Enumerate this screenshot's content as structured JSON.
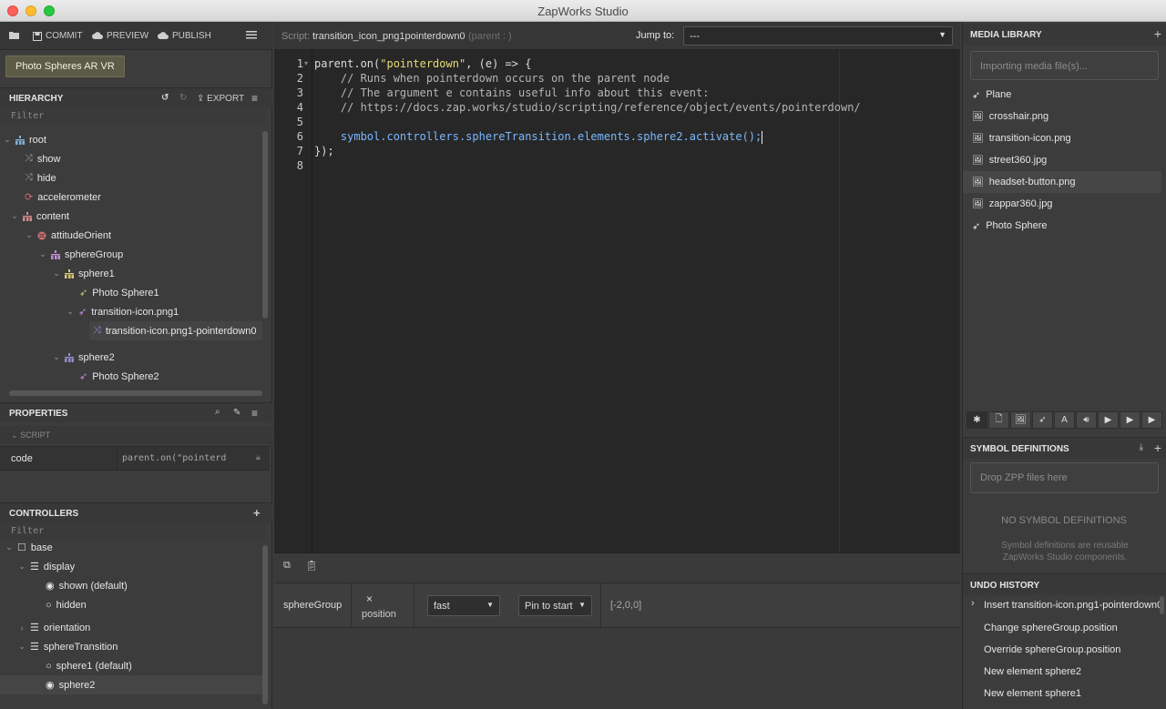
{
  "window": {
    "title": "ZapWorks Studio"
  },
  "toolbar": {
    "commit": "COMMIT",
    "preview": "PREVIEW",
    "publish": "PUBLISH"
  },
  "project": {
    "name": "Photo Spheres AR VR"
  },
  "hierarchy": {
    "title": "HIERARCHY",
    "export": "EXPORT",
    "filter_placeholder": "Filter",
    "items": [
      {
        "label": "root"
      },
      {
        "label": "show"
      },
      {
        "label": "hide"
      },
      {
        "label": "accelerometer"
      },
      {
        "label": "content"
      },
      {
        "label": "attitudeOrient"
      },
      {
        "label": "sphereGroup"
      },
      {
        "label": "sphere1"
      },
      {
        "label": "Photo Sphere1"
      },
      {
        "label": "transition-icon.png1"
      },
      {
        "label": "transition-icon.png1-pointerdown0"
      },
      {
        "label": "sphere2"
      },
      {
        "label": "Photo Sphere2"
      }
    ]
  },
  "properties": {
    "title": "PROPERTIES",
    "group": "SCRIPT",
    "code_label": "code",
    "code_value": "parent.on(\"pointerd"
  },
  "controllers": {
    "title": "CONTROLLERS",
    "filter_placeholder": "Filter",
    "items": [
      {
        "label": "base"
      },
      {
        "label": "display"
      },
      {
        "label": "shown (default)"
      },
      {
        "label": "hidden"
      },
      {
        "label": "orientation"
      },
      {
        "label": "sphereTransition"
      },
      {
        "label": "sphere1 (default)"
      },
      {
        "label": "sphere2"
      }
    ]
  },
  "script": {
    "prefix": "Script:",
    "name": "transition_icon_png1pointerdown0",
    "parent": "(parent : )",
    "jump_label": "Jump to:",
    "jump_value": "---"
  },
  "code": {
    "line_numbers": [
      "1",
      "2",
      "3",
      "4",
      "5",
      "6",
      "7",
      "8"
    ],
    "l1a": "parent.on(",
    "l1b": "\"pointerdown\"",
    "l1c": ", (e) => {",
    "l2": "    // Runs when pointerdown occurs on the parent node",
    "l3": "    // The argument e contains useful info about this event:",
    "l4": "    // https://docs.zap.works/studio/scripting/reference/object/events/pointerdown/",
    "l6": "    symbol.controllers.sphereTransition.elements.sphere2.activate();",
    "l7": "});"
  },
  "timeline": {
    "node": "sphereGroup",
    "prop_icon": "×",
    "prop": "position",
    "easing": "fast",
    "pin": "Pin to start",
    "value": "[-2,0,0]"
  },
  "media": {
    "title": "MEDIA LIBRARY",
    "import_placeholder": "Importing media file(s)...",
    "items": [
      {
        "label": "Plane",
        "icon": "rocket-icon"
      },
      {
        "label": "crosshair.png",
        "icon": "image-icon"
      },
      {
        "label": "transition-icon.png",
        "icon": "image-icon"
      },
      {
        "label": "street360.jpg",
        "icon": "image-icon"
      },
      {
        "label": "headset-button.png",
        "icon": "image-icon"
      },
      {
        "label": "zappar360.jpg",
        "icon": "image-icon"
      },
      {
        "label": "Photo Sphere",
        "icon": "rocket-icon"
      }
    ]
  },
  "symbols": {
    "title": "SYMBOL DEFINITIONS",
    "drop": "Drop ZPP files here",
    "empty_title": "NO SYMBOL DEFINITIONS",
    "empty_desc": "Symbol definitions are reusable ZapWorks Studio components."
  },
  "undo": {
    "title": "UNDO HISTORY",
    "items": [
      {
        "label": "Insert transition-icon.png1-pointerdown0"
      },
      {
        "label": "Change sphereGroup.position"
      },
      {
        "label": "Override sphereGroup.position"
      },
      {
        "label": "New element sphere2"
      },
      {
        "label": "New element sphere1"
      }
    ]
  },
  "colors": {
    "accent": "#5b5b46",
    "node": "#7fb0d8",
    "script": "#9a7fd0",
    "group": "#c78bd6"
  }
}
